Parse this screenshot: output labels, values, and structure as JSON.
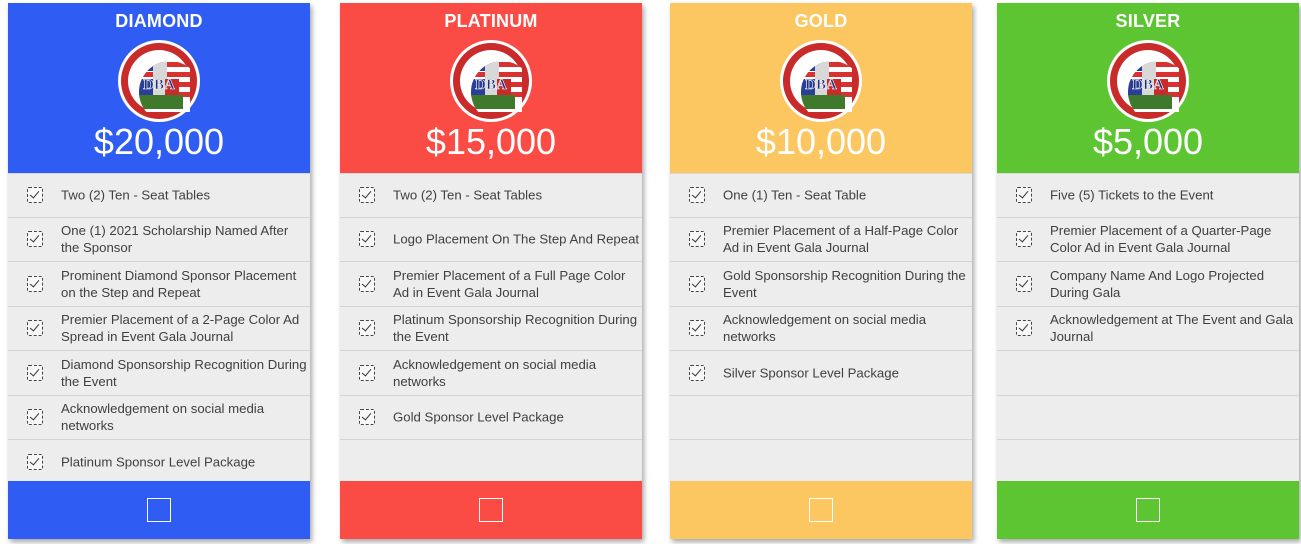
{
  "tiers": [
    {
      "name": "DIAMOND",
      "price": "$20,000",
      "color": "#2f5cf2",
      "features": [
        "Two (2) Ten - Seat Tables",
        "One (1) 2021 Scholarship Named After the Sponsor",
        "Prominent Diamond Sponsor Placement on the Step and Repeat",
        "Premier Placement of a 2-Page Color Ad Spread in Event Gala Journal",
        "Diamond Sponsorship Recognition During the Event",
        "Acknowledgement on social media networks",
        "Platinum Sponsor Level Package"
      ]
    },
    {
      "name": "PLATINUM",
      "price": "$15,000",
      "color": "#fb4b45",
      "features": [
        "Two (2) Ten - Seat Tables",
        "Logo Placement On The Step And Repeat",
        "Premier Placement of a  Full Page Color Ad in Event Gala Journal",
        "Platinum Sponsorship Recognition During the Event",
        "Acknowledgement on social media networks",
        "Gold Sponsor Level Package"
      ]
    },
    {
      "name": "GOLD",
      "price": "$10,000",
      "color": "#fcc660",
      "features": [
        "One (1) Ten - Seat Table",
        "Premier Placement of a  Half-Page Color Ad in Event Gala Journal",
        "Gold Sponsorship Recognition During the Event",
        "Acknowledgement on social media networks",
        "Silver Sponsor Level Package"
      ]
    },
    {
      "name": "SILVER",
      "price": "$5,000",
      "color": "#5cc531",
      "features": [
        "Five (5) Tickets to the Event",
        "Premier Placement of a Quarter-Page Color Ad in Event Gala Journal",
        "Company Name And Logo Projected During Gala",
        "Acknowledgement at The Event and Gala Journal"
      ]
    }
  ],
  "logo": {
    "text_top": "DOMINICAN BAR ASSOCIATION",
    "text_bottom": "EL COLEGIO DE ABOGADOS DOMINICANOS",
    "initials": "DBA"
  }
}
